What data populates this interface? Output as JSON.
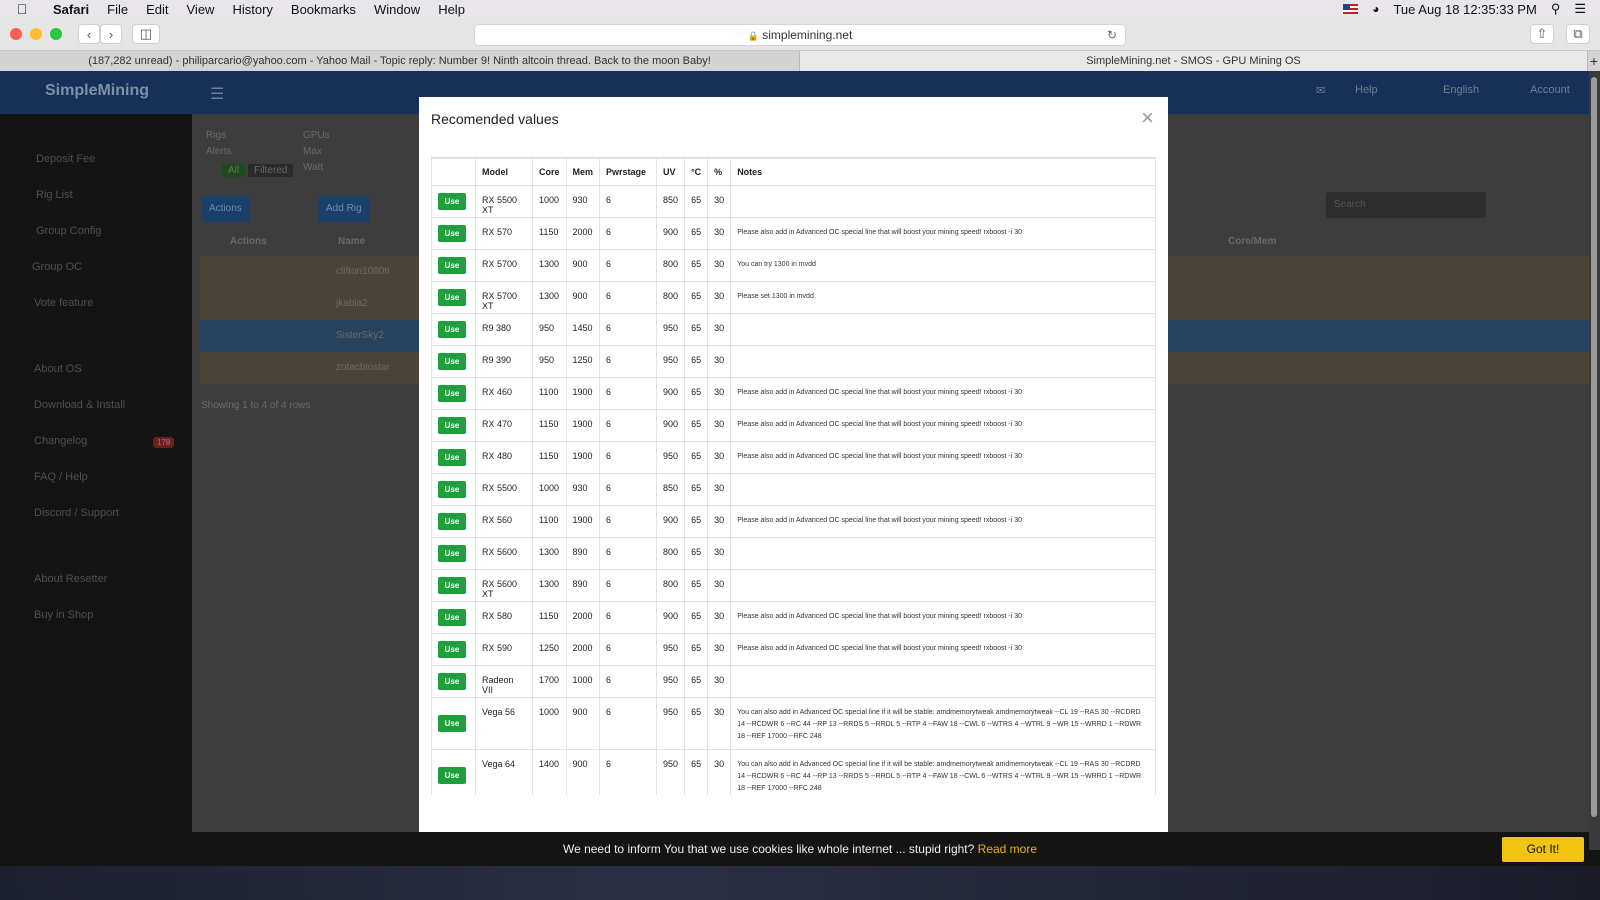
{
  "menubar": {
    "items": [
      "Safari",
      "File",
      "Edit",
      "View",
      "History",
      "Bookmarks",
      "Window",
      "Help"
    ],
    "clock": "Tue Aug 18  12:35:33 PM"
  },
  "toolbar": {
    "address": "simplemining.net"
  },
  "tabs": [
    {
      "label": "(187,282 unread) - philiparcario@yahoo.com - Yahoo Mail - Topic reply: Number 9! Ninth altcoin thread. Back to the moon Baby!"
    },
    {
      "label": "SimpleMining.net - SMOS - GPU Mining OS"
    }
  ],
  "site": {
    "logo": "SimpleMining",
    "nav_right": [
      "Help",
      "English",
      "Account"
    ],
    "sidebar": [
      "Deposit Fee",
      "Rig List",
      "Group Config",
      "Group OC",
      "Vote feature",
      "About OS",
      "Download & Install",
      "Changelog",
      "FAQ / Help",
      "Discord / Support",
      "About Resetter",
      "Buy in Shop"
    ],
    "changelog_badge": "178",
    "buttons": [
      "Actions",
      "Add Rig"
    ],
    "stats": [
      "Rigs",
      "Alerts",
      "GPUs",
      "Max",
      "Watt",
      "All",
      "Filtered"
    ],
    "table_headers": [
      "Actions",
      "Name",
      "Core/Mem"
    ],
    "rig_names": [
      "clifton1080ti",
      "jkabia2",
      "SisterSky2",
      "zotacbiostar"
    ],
    "showing": "Showing 1 to 4 of 4 rows",
    "search_placeholder": "Search"
  },
  "modal": {
    "title": "Recomended values",
    "close": "×",
    "columns": [
      "",
      "Model",
      "Core",
      "Mem",
      "Pwrstage",
      "UV",
      "°C",
      "%",
      "Notes"
    ],
    "use_label": "Use",
    "rows": [
      {
        "model": "RX 5500 XT",
        "core": "1000",
        "mem": "930",
        "pwr": "6",
        "uv": "850",
        "temp": "65",
        "pct": "30",
        "note": ""
      },
      {
        "model": "RX 570",
        "core": "1150",
        "mem": "2000",
        "pwr": "6",
        "uv": "900",
        "temp": "65",
        "pct": "30",
        "note": "Please also add in Advanced OC special line that will boost your mining speed! rxboost -i 30"
      },
      {
        "model": "RX 5700",
        "core": "1300",
        "mem": "900",
        "pwr": "6",
        "uv": "800",
        "temp": "65",
        "pct": "30",
        "note": "You can try 1300 in mvdd"
      },
      {
        "model": "RX 5700 XT",
        "core": "1300",
        "mem": "900",
        "pwr": "6",
        "uv": "800",
        "temp": "65",
        "pct": "30",
        "note": "Please set 1300 in mvdd"
      },
      {
        "model": "R9 380",
        "core": "950",
        "mem": "1450",
        "pwr": "6",
        "uv": "950",
        "temp": "65",
        "pct": "30",
        "note": ""
      },
      {
        "model": "R9 390",
        "core": "950",
        "mem": "1250",
        "pwr": "6",
        "uv": "950",
        "temp": "65",
        "pct": "30",
        "note": ""
      },
      {
        "model": "RX 460",
        "core": "1100",
        "mem": "1900",
        "pwr": "6",
        "uv": "900",
        "temp": "65",
        "pct": "30",
        "note": "Please also add in Advanced OC special line that will boost your mining speed! rxboost -i 30"
      },
      {
        "model": "RX 470",
        "core": "1150",
        "mem": "1900",
        "pwr": "6",
        "uv": "900",
        "temp": "65",
        "pct": "30",
        "note": "Please also add in Advanced OC special line that will boost your mining speed! rxboost -i 30"
      },
      {
        "model": "RX 480",
        "core": "1150",
        "mem": "1900",
        "pwr": "6",
        "uv": "950",
        "temp": "65",
        "pct": "30",
        "note": "Please also add in Advanced OC special line that will boost your mining speed! rxboost -i 30"
      },
      {
        "model": "RX 5500",
        "core": "1000",
        "mem": "930",
        "pwr": "6",
        "uv": "850",
        "temp": "65",
        "pct": "30",
        "note": ""
      },
      {
        "model": "RX 560",
        "core": "1100",
        "mem": "1900",
        "pwr": "6",
        "uv": "900",
        "temp": "65",
        "pct": "30",
        "note": "Please also add in Advanced OC special line that will boost your mining speed! rxboost -i 30"
      },
      {
        "model": "RX 5600",
        "core": "1300",
        "mem": "890",
        "pwr": "6",
        "uv": "800",
        "temp": "65",
        "pct": "30",
        "note": ""
      },
      {
        "model": "RX 5600 XT",
        "core": "1300",
        "mem": "890",
        "pwr": "6",
        "uv": "800",
        "temp": "65",
        "pct": "30",
        "note": ""
      },
      {
        "model": "RX 580",
        "core": "1150",
        "mem": "2000",
        "pwr": "6",
        "uv": "900",
        "temp": "65",
        "pct": "30",
        "note": "Please also add in Advanced OC special line that will boost your mining speed! rxboost -i 30"
      },
      {
        "model": "RX 590",
        "core": "1250",
        "mem": "2000",
        "pwr": "6",
        "uv": "950",
        "temp": "65",
        "pct": "30",
        "note": "Please also add in Advanced OC special line that will boost your mining speed! rxboost -i 30"
      },
      {
        "model": "Radeon VII",
        "core": "1700",
        "mem": "1000",
        "pwr": "6",
        "uv": "950",
        "temp": "65",
        "pct": "30",
        "note": ""
      },
      {
        "model": "Vega 56",
        "core": "1000",
        "mem": "900",
        "pwr": "6",
        "uv": "950",
        "temp": "65",
        "pct": "30",
        "note": "You can also add in Advanced OC special line if it will be stable: amdmemorytweak amdmemorytweak --CL 19 --RAS 30 --RCDRD 14 --RCDWR 6 --RC 44 --RP 13 --RRDS 5 --RRDL 5 --RTP 4 --FAW 18 --CWL 6 --WTRS 4 --WTRL 9 --WR 15 --WRRD 1 --RDWR 18 --REF 17000 --RFC 248",
        "tall": true
      },
      {
        "model": "Vega 64",
        "core": "1400",
        "mem": "900",
        "pwr": "6",
        "uv": "950",
        "temp": "65",
        "pct": "30",
        "note": "You can also add in Advanced OC special line if it will be stable: amdmemorytweak amdmemorytweak --CL 19 --RAS 30 --RCDRD 14 --RCDWR 6 --RC 44 --RP 13 --RRDS 5 --RRDL 5 --RTP 4 --FAW 18 --CWL 6 --WTRS 4 --WTRL 9 --WR 15 --WRRD 1 --RDWR 18 --REF 17000 --RFC 248",
        "tall": true
      }
    ]
  },
  "cookie": {
    "text": "We need to inform You that we use cookies like whole internet ... stupid right?",
    "link": "Read more",
    "button": "Got It!"
  }
}
